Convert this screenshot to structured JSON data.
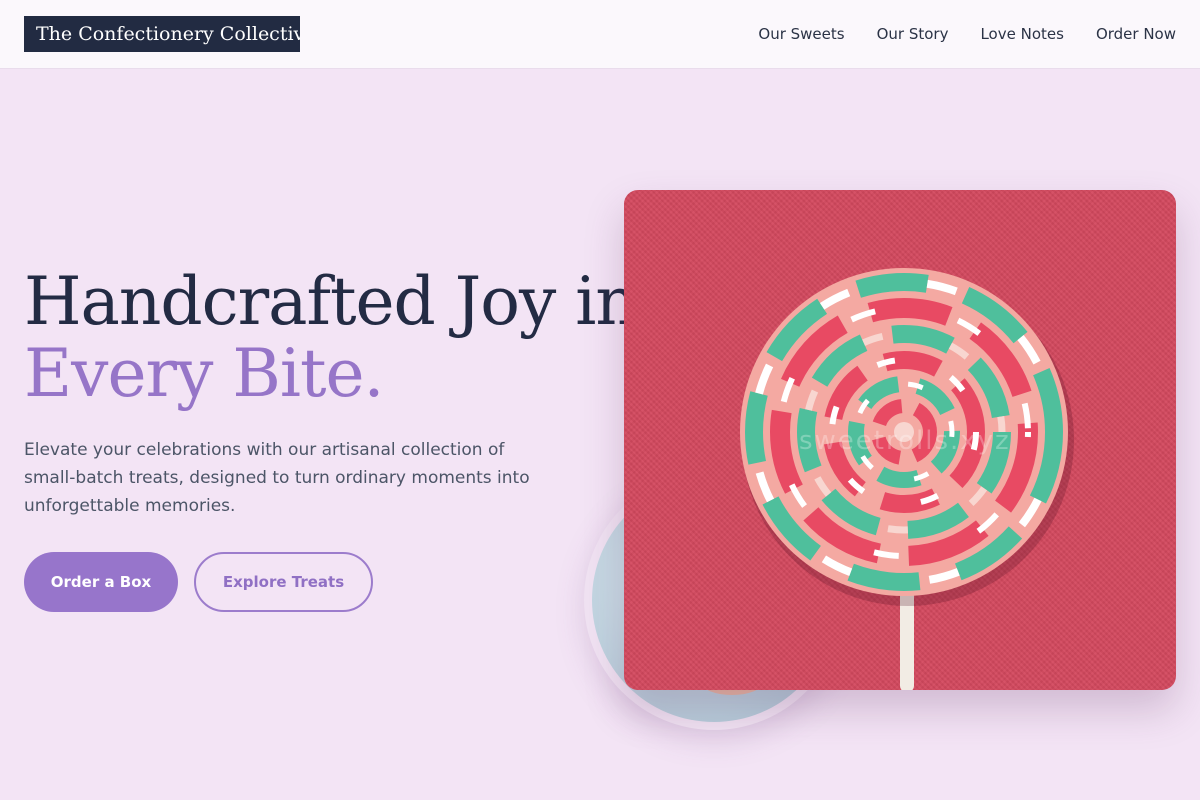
{
  "header": {
    "brand": "The Confectionery Collective",
    "nav": [
      "Our Sweets",
      "Our Story",
      "Love Notes",
      "Order Now"
    ]
  },
  "hero": {
    "headline_line1": "Handcrafted Joy in",
    "headline_line2": "Every Bite.",
    "subtext": "Elevate your celebrations with our artisanal collection of small-batch treats, designed to turn ordinary moments into unforgettable memories.",
    "primary_button": "Order a Box",
    "secondary_button": "Explore Treats"
  },
  "images": {
    "main_watermark": "sweetrolls.xyz"
  },
  "colors": {
    "background": "#f3e4f5",
    "accent": "#9775cb",
    "brand_bg": "#222b42",
    "photo_bg": "#d4495f"
  }
}
